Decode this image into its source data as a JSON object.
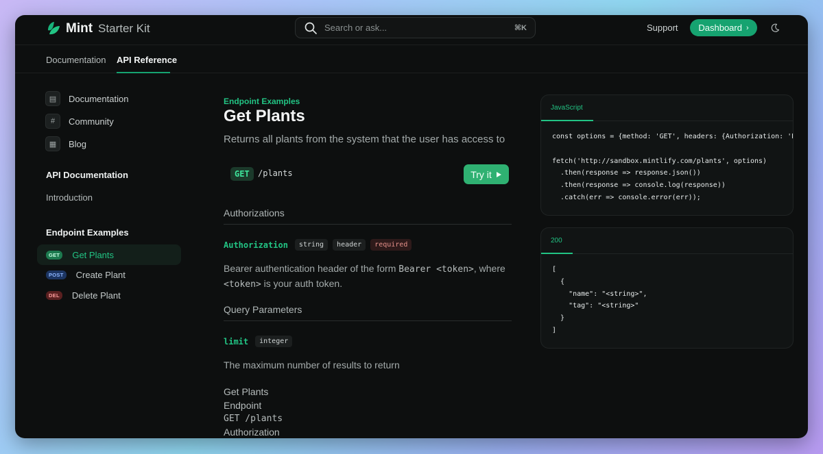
{
  "header": {
    "logo_name": "Mint",
    "logo_sub": "Starter Kit",
    "search_placeholder": "Search or ask...",
    "search_shortcut": "⌘K",
    "support": "Support",
    "dashboard": "Dashboard",
    "dashboard_chevron": "›"
  },
  "tabs": [
    {
      "label": "Documentation",
      "active": false
    },
    {
      "label": "API Reference",
      "active": true
    }
  ],
  "sidebar": {
    "links": [
      {
        "label": "Documentation",
        "icon": "book-icon",
        "glyph": "▤"
      },
      {
        "label": "Community",
        "icon": "slack-icon",
        "glyph": "#"
      },
      {
        "label": "Blog",
        "icon": "newspaper-icon",
        "glyph": "▦"
      }
    ],
    "api_heading": "API Documentation",
    "introduction": "Introduction",
    "endpoints_heading": "Endpoint Examples",
    "endpoints": [
      {
        "method": "GET",
        "label": "Get Plants",
        "active": true
      },
      {
        "method": "POST",
        "label": "Create Plant",
        "active": false
      },
      {
        "method": "DEL",
        "label": "Delete Plant",
        "active": false
      }
    ]
  },
  "main": {
    "eyebrow": "Endpoint Examples",
    "title": "Get Plants",
    "description": "Returns all plants from the system that the user has access to",
    "method": "GET",
    "path": "/plants",
    "try_it": "Try it",
    "authorizations_title": "Authorizations",
    "auth_param": {
      "name": "Authorization",
      "tags": [
        "string",
        "header"
      ],
      "required": "required",
      "desc_1": "Bearer authentication header of the form ",
      "desc_code_1": "Bearer <token>",
      "desc_2": ", where ",
      "desc_code_2": "<token>",
      "desc_3": " is your auth token."
    },
    "query_title": "Query Parameters",
    "limit_param": {
      "name": "limit",
      "type": "integer",
      "desc": "The maximum number of results to return"
    },
    "footer_lines": [
      "Get Plants",
      "Endpoint",
      "GET /plants",
      "Authorization"
    ]
  },
  "request_panel": {
    "tab": "JavaScript",
    "code": "const options = {method: 'GET', headers: {Authorization: 'Be\n\nfetch('http://sandbox.mintlify.com/plants', options)\n  .then(response => response.json())\n  .then(response => console.log(response))\n  .catch(err => console.error(err));"
  },
  "response_panel": {
    "tab": "200",
    "code": "[\n  {\n    \"name\": \"<string>\",\n    \"tag\": \"<string>\"\n  }\n]"
  },
  "colors": {
    "accent": "#16a370",
    "accent_text": "#22c484",
    "background": "#0d0f0f"
  }
}
